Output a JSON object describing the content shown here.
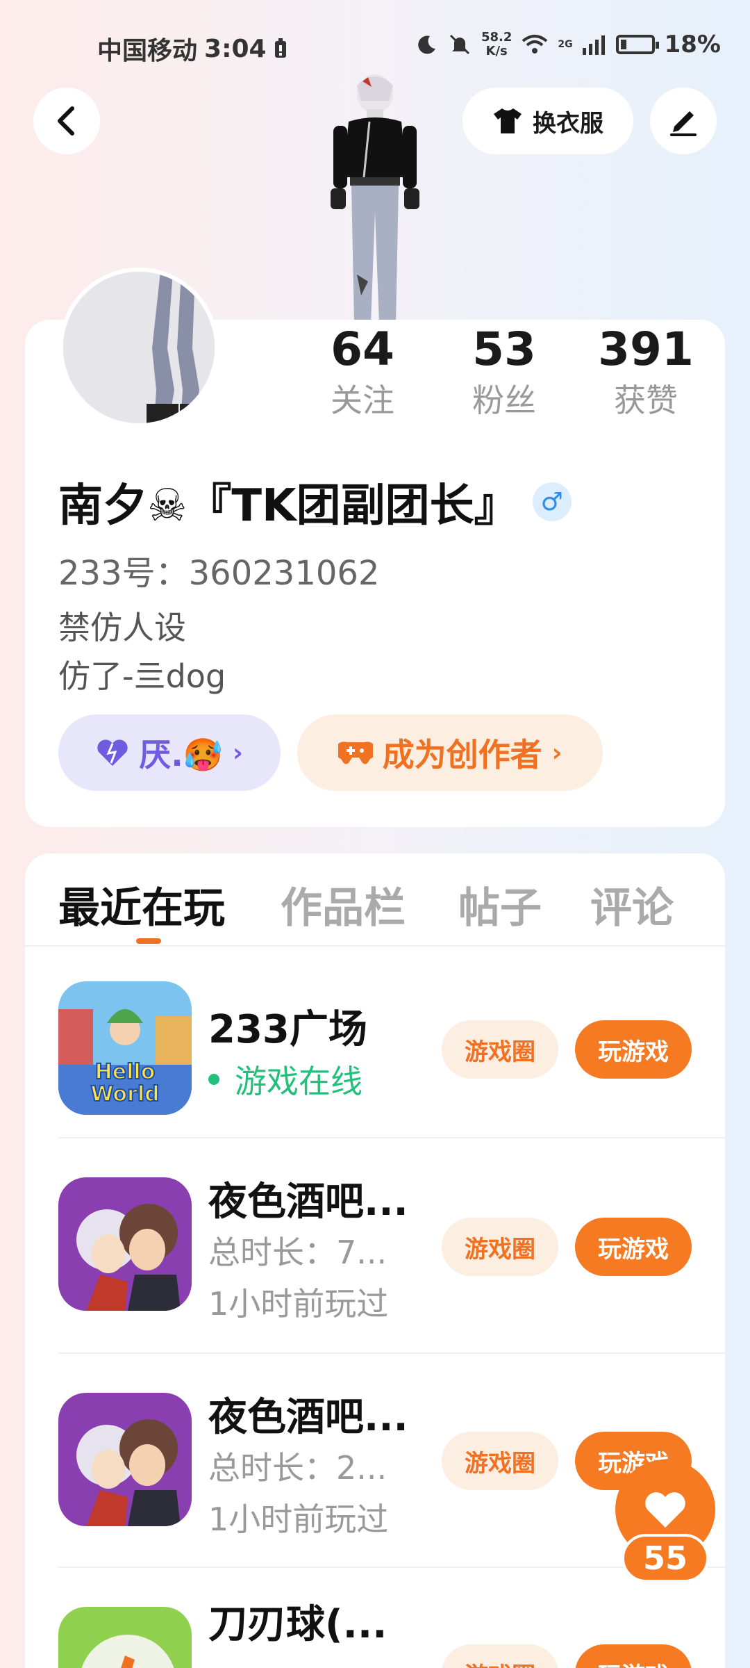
{
  "status_bar": {
    "carrier": "中国移动",
    "time": "3:04",
    "net_speed_value": "58.2",
    "net_speed_unit": "K/s",
    "signal_label": "2G",
    "battery": "18%",
    "battery_level": 0.18
  },
  "header": {
    "back_icon": "chevron-left-icon",
    "change_outfit_label": "换衣服",
    "edit_icon": "pencil-icon"
  },
  "profile": {
    "stats": [
      {
        "value": "64",
        "label": "关注"
      },
      {
        "value": "53",
        "label": "粉丝"
      },
      {
        "value": "391",
        "label": "获赞"
      }
    ],
    "nickname": "南夕☠『TK团副团长』",
    "gender_symbol": "♂",
    "uid": "233号：360231062",
    "bio_line1": "禁仿人设",
    "bio_line2": "仿了-亖dog",
    "fan_chip_label": "厌.🥵",
    "creator_chip_label": "成为创作者"
  },
  "tabs": [
    {
      "label": "最近在玩",
      "active": true
    },
    {
      "label": "作品栏",
      "active": false
    },
    {
      "label": "帖子",
      "active": false
    },
    {
      "label": "评论",
      "active": false
    }
  ],
  "games": [
    {
      "title": "233广场",
      "status": "游戏在线",
      "circle_label": "游戏圈",
      "play_label": "玩游戏"
    },
    {
      "title": "夜色酒吧...",
      "duration": "总时长：7...",
      "last_played": "1小时前玩过",
      "circle_label": "游戏圈",
      "play_label": "玩游戏"
    },
    {
      "title": "夜色酒吧...",
      "duration": "总时长：2...",
      "last_played": "1小时前玩过",
      "circle_label": "游戏圈",
      "play_label": "玩游戏"
    },
    {
      "title": "刀刃球(...",
      "circle_label": "游戏圈",
      "play_label": "玩游戏"
    }
  ],
  "like_count": "55",
  "colors": {
    "accent": "#f57a21",
    "online": "#22c07a",
    "fan_chip": "#6e5de0"
  }
}
